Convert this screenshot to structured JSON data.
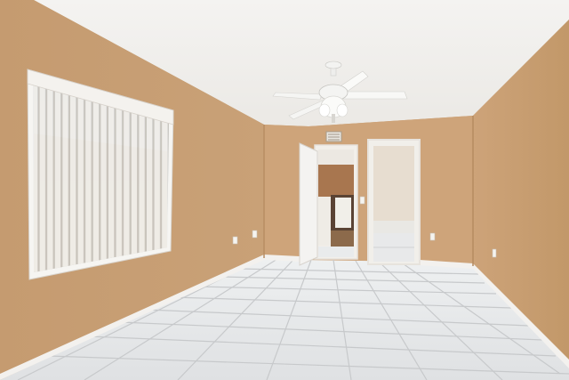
{
  "scene": {
    "subject": "empty-room-interior",
    "colors": {
      "ceiling": "#f1f0ed",
      "wall_left": "#c79d72",
      "wall_back": "#cfa57b",
      "wall_right": "#c69b70",
      "floor": "#e5e7e8",
      "grout": "#c9cbcd",
      "baseboard": "#f3f1ee",
      "door": "#f4f3f1",
      "blinds": "#eeebe6",
      "window_frame": "#f6f5f2",
      "fan": "#f7f7f5"
    }
  }
}
